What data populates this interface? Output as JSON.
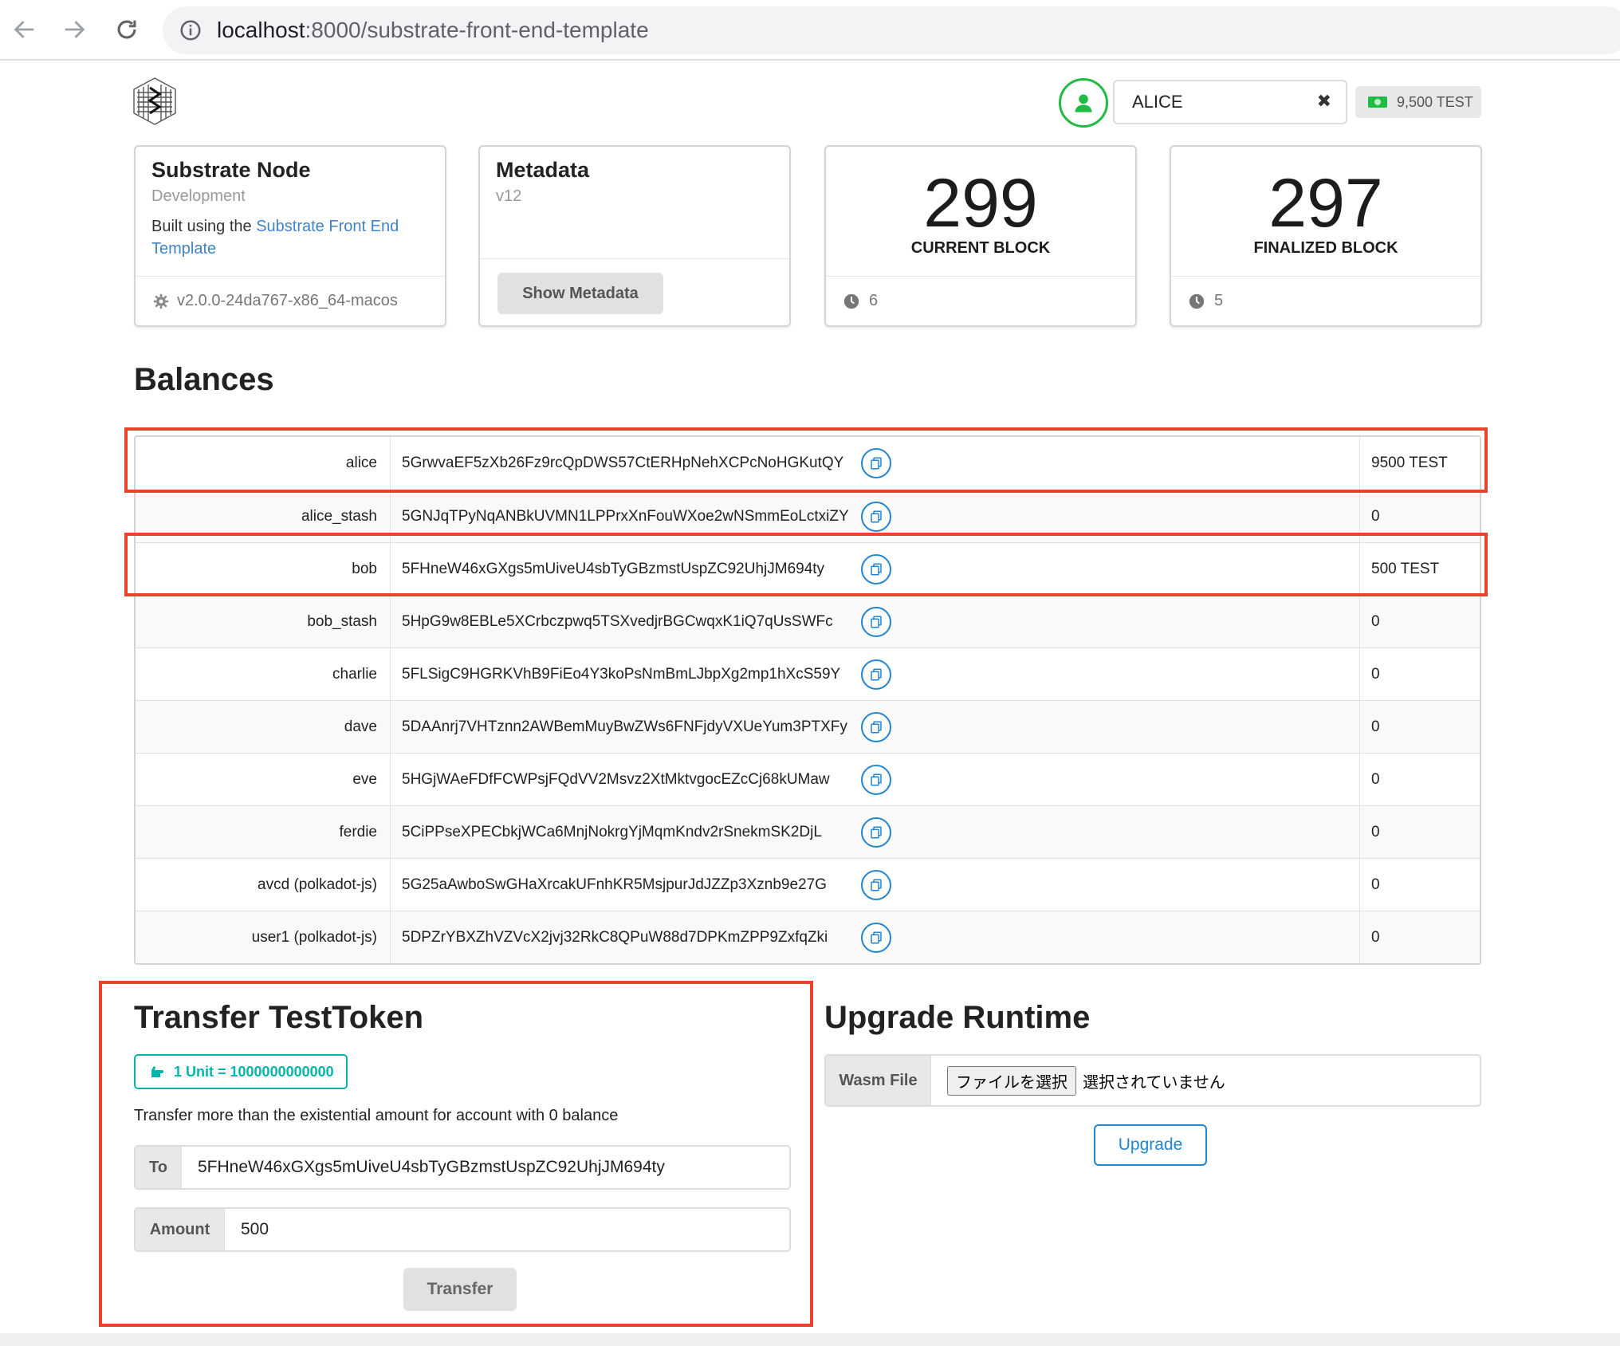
{
  "browser": {
    "url_host": "localhost",
    "url_path": ":8000/substrate-front-end-template"
  },
  "header": {
    "account_name": "ALICE",
    "clear_symbol": "✖",
    "balance": "9,500 TEST"
  },
  "cards": {
    "node": {
      "title": "Substrate Node",
      "meta": "Development",
      "desc_prefix": "Built using the ",
      "desc_link": "Substrate Front End Template",
      "version": "v2.0.0-24da767-x86_64-macos"
    },
    "metadata": {
      "title": "Metadata",
      "meta": "v12",
      "button": "Show Metadata"
    },
    "current_block": {
      "value": "299",
      "label": "Current Block",
      "timer": "6"
    },
    "finalized_block": {
      "value": "297",
      "label": "Finalized Block",
      "timer": "5"
    }
  },
  "balances": {
    "title": "Balances",
    "rows": [
      {
        "name": "alice",
        "address": "5GrwvaEF5zXb26Fz9rcQpDWS57CtERHpNehXCPcNoHGKutQY",
        "balance": "9500 TEST"
      },
      {
        "name": "alice_stash",
        "address": "5GNJqTPyNqANBkUVMN1LPPrxXnFouWXoe2wNSmmEoLctxiZY",
        "balance": "0"
      },
      {
        "name": "bob",
        "address": "5FHneW46xGXgs5mUiveU4sbTyGBzmstUspZC92UhjJM694ty",
        "balance": "500 TEST"
      },
      {
        "name": "bob_stash",
        "address": "5HpG9w8EBLe5XCrbczpwq5TSXvedjrBGCwqxK1iQ7qUsSWFc",
        "balance": "0"
      },
      {
        "name": "charlie",
        "address": "5FLSigC9HGRKVhB9FiEo4Y3koPsNmBmLJbpXg2mp1hXcS59Y",
        "balance": "0"
      },
      {
        "name": "dave",
        "address": "5DAAnrj7VHTznn2AWBemMuyBwZWs6FNFjdyVXUeYum3PTXFy",
        "balance": "0"
      },
      {
        "name": "eve",
        "address": "5HGjWAeFDfFCWPsjFQdVV2Msvz2XtMktvgocEZcCj68kUMaw",
        "balance": "0"
      },
      {
        "name": "ferdie",
        "address": "5CiPPseXPECbkjWCa6MnjNokrgYjMqmKndv2rSnekmSK2DjL",
        "balance": "0"
      },
      {
        "name": "avcd (polkadot-js)",
        "address": "5G25aAwboSwGHaXrcakUFnhKR5MsjpurJdJZZp3Xznb9e27G",
        "balance": "0"
      },
      {
        "name": "user1 (polkadot-js)",
        "address": "5DPZrYBXZhVZVcX2jvj32RkC8QPuW88d7DPKmZPP9ZxfqZki",
        "balance": "0"
      }
    ]
  },
  "transfer": {
    "title": "Transfer TestToken",
    "unit_label": "1 Unit = 1000000000000",
    "note": "Transfer more than the existential amount for account with 0 balance",
    "to_label": "To",
    "to_value": "5FHneW46xGXgs5mUiveU4sbTyGBzmstUspZC92UhjJM694ty",
    "amount_label": "Amount",
    "amount_value": "500",
    "button": "Transfer"
  },
  "upgrade": {
    "title": "Upgrade Runtime",
    "file_label": "Wasm File",
    "choose_button": "ファイルを選択",
    "no_file": "選択されていません",
    "button": "Upgrade"
  },
  "colors": {
    "highlight": "#e8432f",
    "link": "#4183c4",
    "teal": "#00b5ad",
    "green": "#21ba45",
    "blue": "#2185d0"
  }
}
